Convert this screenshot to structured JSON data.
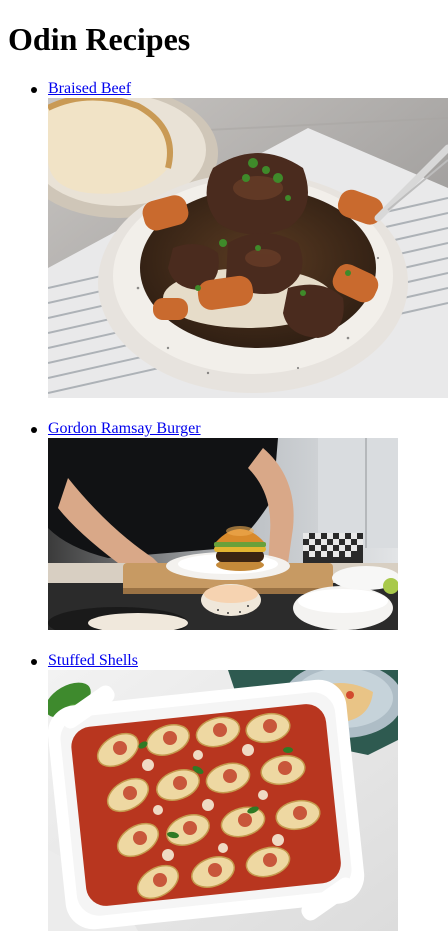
{
  "page": {
    "title": "Odin Recipes"
  },
  "recipes": [
    {
      "name": "Braised Beef"
    },
    {
      "name": "Gordon Ramsay Burger"
    },
    {
      "name": "Stuffed Shells"
    }
  ],
  "colors": {
    "link": "#0000ee",
    "background": "#ffffff",
    "text": "#000000"
  }
}
